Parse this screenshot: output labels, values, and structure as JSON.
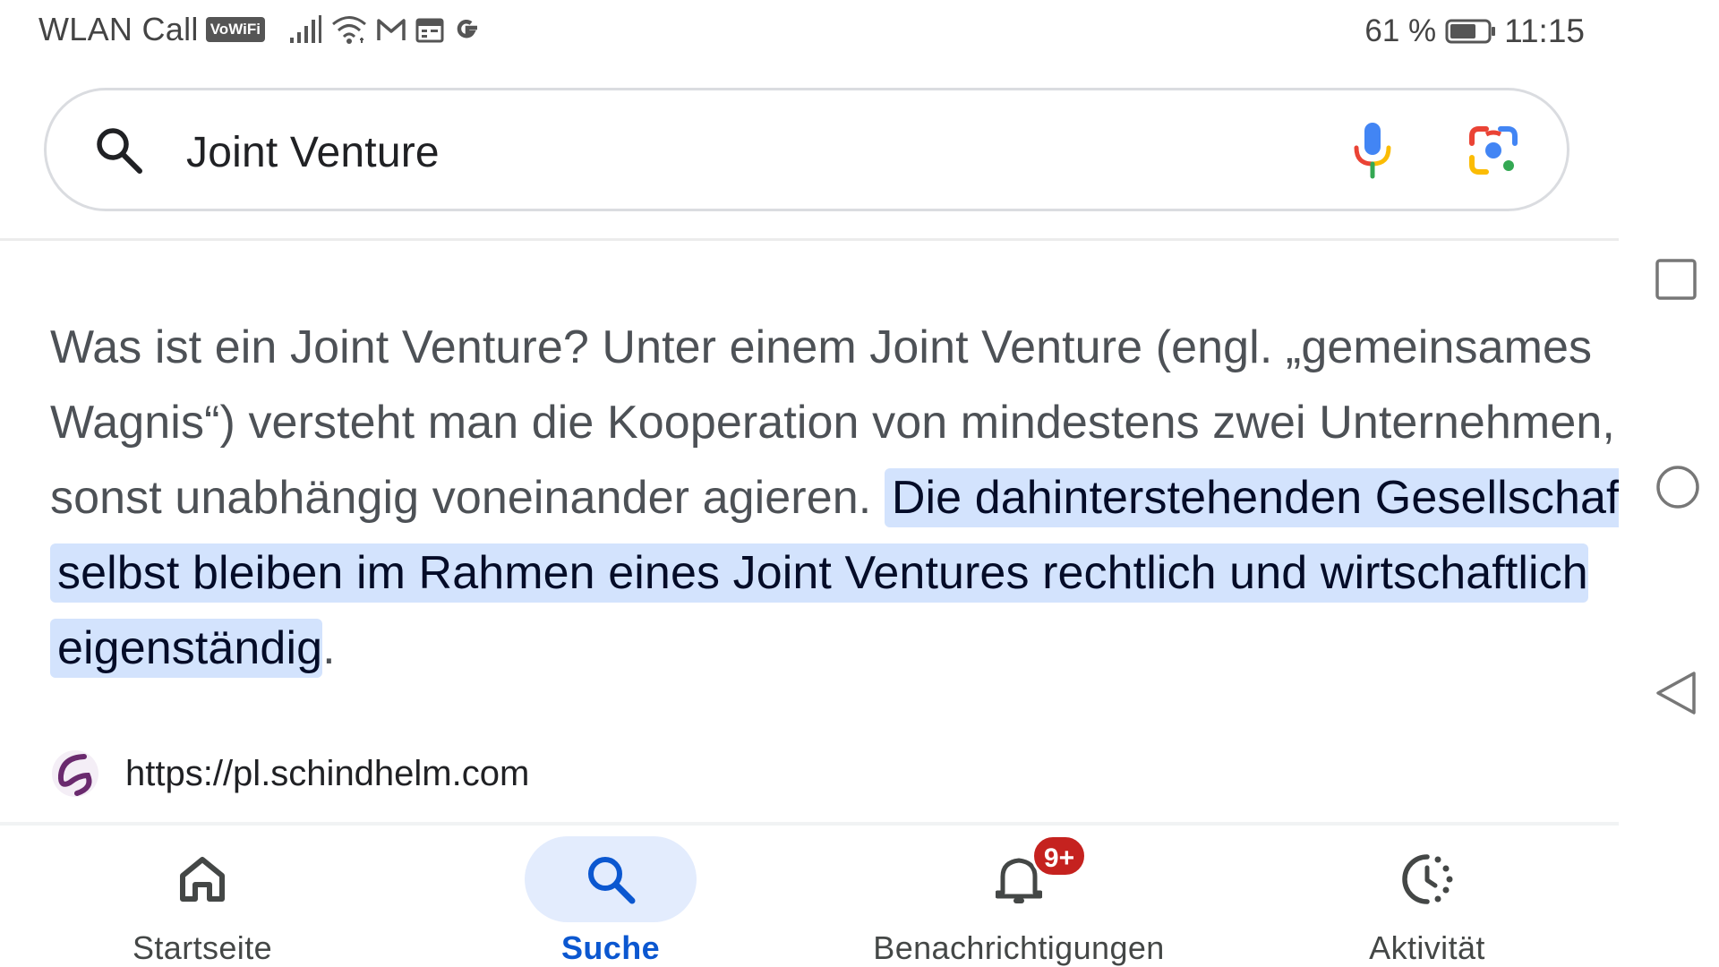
{
  "status_bar": {
    "carrier": "WLAN Call",
    "vowifi_badge": "VoWiFi",
    "battery_percent": "61 %",
    "time": "11:15",
    "icons": [
      "signal-icon",
      "wifi-icon",
      "gmail-icon",
      "calendar-icon",
      "google-icon",
      "battery-icon"
    ]
  },
  "search": {
    "query": "Joint Venture",
    "icons": [
      "search-icon",
      "microphone-icon",
      "google-lens-icon"
    ]
  },
  "snippet": {
    "text_plain": "Was ist ein Joint Venture? Unter einem Joint Venture (engl. „gemeinsames Wagnis“) versteht man die Kooperation von mindestens zwei Unternehmen, die sonst unabhängig voneinander agieren. ",
    "text_highlight": "Die dahinterstehenden Gesellschaften selbst bleiben im Rahmen eines Joint Ventures rechtlich und wirtschaftlich eigenständig",
    "text_tail": "."
  },
  "source": {
    "url": "https://pl.schindhelm.com",
    "logo": "schindhelm-logo"
  },
  "bottom_nav": {
    "items": [
      {
        "label": "Startseite",
        "icon": "home-icon",
        "active": false
      },
      {
        "label": "Suche",
        "icon": "search-icon",
        "active": true
      },
      {
        "label": "Benachrichtigungen",
        "icon": "bell-icon",
        "active": false,
        "badge": "9+"
      },
      {
        "label": "Aktivität",
        "icon": "activity-icon",
        "active": false
      }
    ]
  },
  "system_nav": {
    "buttons": [
      "recents-button",
      "home-button",
      "back-button"
    ]
  },
  "colors": {
    "highlight_bg": "#d3e3fd",
    "active_nav": "#0b57d0",
    "active_nav_bg": "#e3ecfd",
    "badge": "#c5221f",
    "snippet_text": "#4d5156"
  }
}
